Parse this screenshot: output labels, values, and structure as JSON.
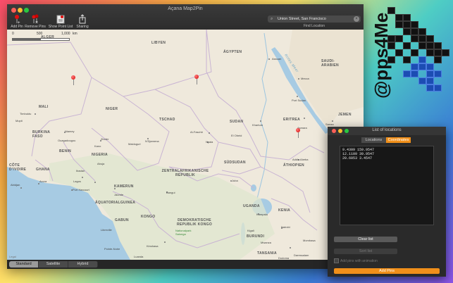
{
  "window": {
    "title": "Açana Map2Pin"
  },
  "toolbar": {
    "add_pin": "Add Pin",
    "remove_pins": "Remove Pins",
    "show_point_list": "Show Point List",
    "sharing": "Sharing"
  },
  "search": {
    "value": "Union Street, San Francisco",
    "find_label": "Find Location"
  },
  "map": {
    "scale": {
      "zero": "0",
      "mid": "500",
      "end": "1,000",
      "unit": "km"
    },
    "countries": [
      "ALGER",
      "LIBYEN",
      "ÄGYPTEN",
      "SAUDI-ARABIEN",
      "MALI",
      "NIGER",
      "TSCHAD",
      "SUDAN",
      "ERITREA",
      "JEMEN",
      "BURKINA FASO",
      "BENIN",
      "NIGERIA",
      "CÔTE D'IVOIRE",
      "GHANA",
      "ZENTRALAFRIKANISCHE REPUBLIK",
      "SÜDSUDAN",
      "ÄTHIOPIEN",
      "KAMERUN",
      "ÄQUATORIALGUINEA",
      "GABUN",
      "KONGO",
      "DEMOKRATISCHE REPUBLIK KONGO",
      "UGANDA",
      "KENIA",
      "BURUNDI",
      "TANSANIA"
    ],
    "cities": [
      "Assuan",
      "Mecca",
      "Port Sudan",
      "Asmara",
      "Khartum",
      "Sanaa",
      "Timbuktu",
      "Mopti",
      "Niamey",
      "Ouagadougou",
      "Kano",
      "Maiduguri",
      "Zinder",
      "N'Djamena",
      "Al-Faschir",
      "Nyala",
      "El Obeid",
      "Addis Abeba",
      "Abuja",
      "Ibadan",
      "Lagos",
      "Accra",
      "Abidjan",
      "Port Harcourt",
      "Jaunde",
      "Libreville",
      "Bangui",
      "Juba",
      "Kampala",
      "Nairobi",
      "Mombasa",
      "Daressalam",
      "Kinshasa",
      "Luanda",
      "Pointe-Noire",
      "Kigali",
      "Mwanza",
      "Dodoma"
    ],
    "seas": [
      "Rotes Meer"
    ],
    "park": "Nationalpark Salonga",
    "legal": "Legal"
  },
  "map_type": {
    "options": [
      "Standard",
      "Satellite",
      "Hybrid"
    ],
    "selected": "Standard"
  },
  "list_window": {
    "title": "List of locations",
    "tabs": [
      "Locations",
      "Coordinates"
    ],
    "selected_tab": "Coordinates",
    "coordinates": [
      "9.4309 159.9547",
      "12.1109 39.9547",
      "20.6053 3.4547"
    ],
    "clear_label": "Clear list",
    "sort_label": "Sort list",
    "animation_label": "Add pins with animation",
    "add_label": "Add Pins"
  },
  "logo": {
    "text": "@pps4Me"
  },
  "colors": {
    "accent": "#f08f1a",
    "pin": "#d50000",
    "logo_blue": "#1c4db3"
  }
}
